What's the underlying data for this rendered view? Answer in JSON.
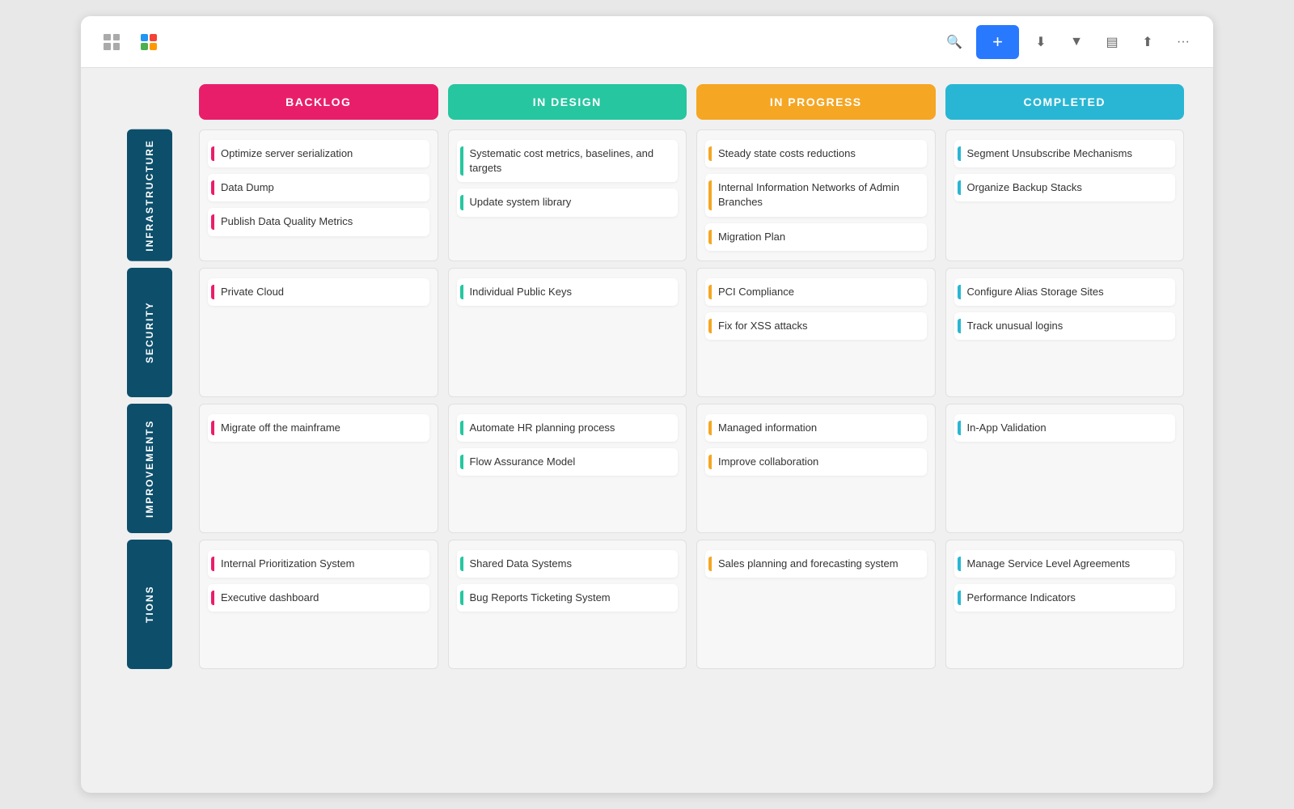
{
  "toolbar": {
    "add_label": "+",
    "more_label": "···"
  },
  "columns": [
    {
      "id": "backlog",
      "label": "BACKLOG",
      "class": "backlog"
    },
    {
      "id": "in-design",
      "label": "IN DESIGN",
      "class": "in-design"
    },
    {
      "id": "in-progress",
      "label": "IN PROGRESS",
      "class": "in-progress"
    },
    {
      "id": "completed",
      "label": "COMPLETED",
      "class": "completed"
    }
  ],
  "rows": [
    {
      "label": "INFRASTRUCTURE",
      "cells": {
        "backlog": [
          "Optimize server serialization",
          "Data Dump",
          "Publish Data Quality Metrics"
        ],
        "in-design": [
          "Systematic cost metrics, baselines, and targets",
          "Update system library"
        ],
        "in-progress": [
          "Steady state costs reductions",
          "Internal Information Networks of Admin Branches",
          "Migration Plan"
        ],
        "completed": [
          "Segment Unsubscribe Mechanisms",
          "Organize Backup Stacks"
        ]
      }
    },
    {
      "label": "SECURITY",
      "cells": {
        "backlog": [
          "Private Cloud"
        ],
        "in-design": [
          "Individual Public Keys"
        ],
        "in-progress": [
          "PCI Compliance",
          "Fix for XSS attacks"
        ],
        "completed": [
          "Configure Alias Storage Sites",
          "Track unusual logins"
        ]
      }
    },
    {
      "label": "IMPROVEMENTS",
      "cells": {
        "backlog": [
          "Migrate off the mainframe"
        ],
        "in-design": [
          "Automate HR planning process",
          "Flow Assurance Model"
        ],
        "in-progress": [
          "Managed information",
          "Improve collaboration"
        ],
        "completed": [
          "In-App Validation"
        ]
      }
    },
    {
      "label": "TIONS",
      "cells": {
        "backlog": [
          "Internal Prioritization System",
          "Executive dashboard"
        ],
        "in-design": [
          "Shared Data Systems",
          "Bug Reports Ticketing System"
        ],
        "in-progress": [
          "Sales planning and forecasting system"
        ],
        "completed": [
          "Manage Service Level Agreements",
          "Performance Indicators"
        ]
      }
    }
  ],
  "colors": {
    "backlog": "#E91E6B",
    "in-design": "#26C6A0",
    "in-progress": "#F5A623",
    "completed": "#29B6D4"
  }
}
